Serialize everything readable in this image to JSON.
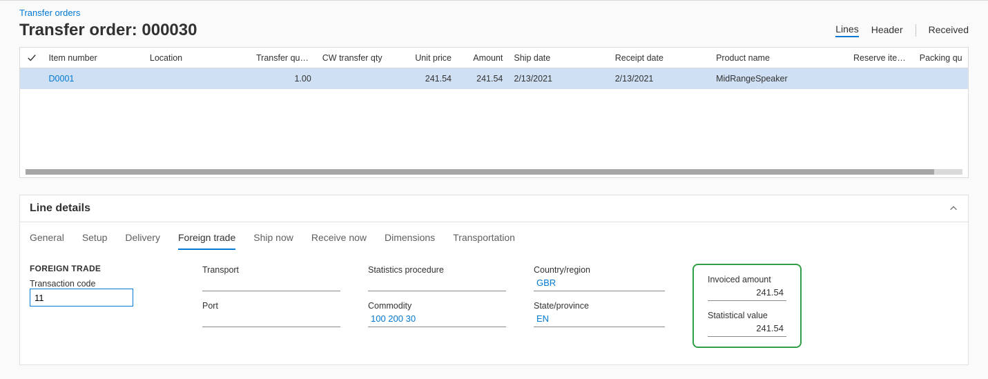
{
  "breadcrumb": "Transfer orders",
  "title": "Transfer order: 000030",
  "viewTabs": {
    "lines": "Lines",
    "header": "Header",
    "received": "Received"
  },
  "gridHeaders": {
    "item": "Item number",
    "location": "Location",
    "tq": "Transfer quantity",
    "cwtq": "CW transfer qty",
    "up": "Unit price",
    "amt": "Amount",
    "ship": "Ship date",
    "rcpt": "Receipt date",
    "prod": "Product name",
    "res": "Reserve items a...",
    "pack": "Packing qu"
  },
  "row": {
    "item": "D0001",
    "location": "",
    "tq": "1.00",
    "cwtq": "",
    "up": "241.54",
    "amt": "241.54",
    "ship": "2/13/2021",
    "rcpt": "2/13/2021",
    "prod": "MidRangeSpeaker",
    "res": "",
    "pack": ""
  },
  "details": {
    "title": "Line details",
    "tabs": {
      "general": "General",
      "setup": "Setup",
      "delivery": "Delivery",
      "foreign": "Foreign trade",
      "shipnow": "Ship now",
      "recvnow": "Receive now",
      "dims": "Dimensions",
      "transport": "Transportation"
    }
  },
  "ft": {
    "heading": "FOREIGN TRADE",
    "labels": {
      "txn": "Transaction code",
      "transport": "Transport",
      "port": "Port",
      "stats": "Statistics procedure",
      "commodity": "Commodity",
      "country": "Country/region",
      "state": "State/province",
      "invoiced": "Invoiced amount",
      "statval": "Statistical value"
    },
    "values": {
      "txn": "11",
      "transport": "",
      "port": "",
      "stats": "",
      "commodity": "100 200 30",
      "country": "GBR",
      "state": "EN",
      "invoiced": "241.54",
      "statval": "241.54"
    }
  }
}
